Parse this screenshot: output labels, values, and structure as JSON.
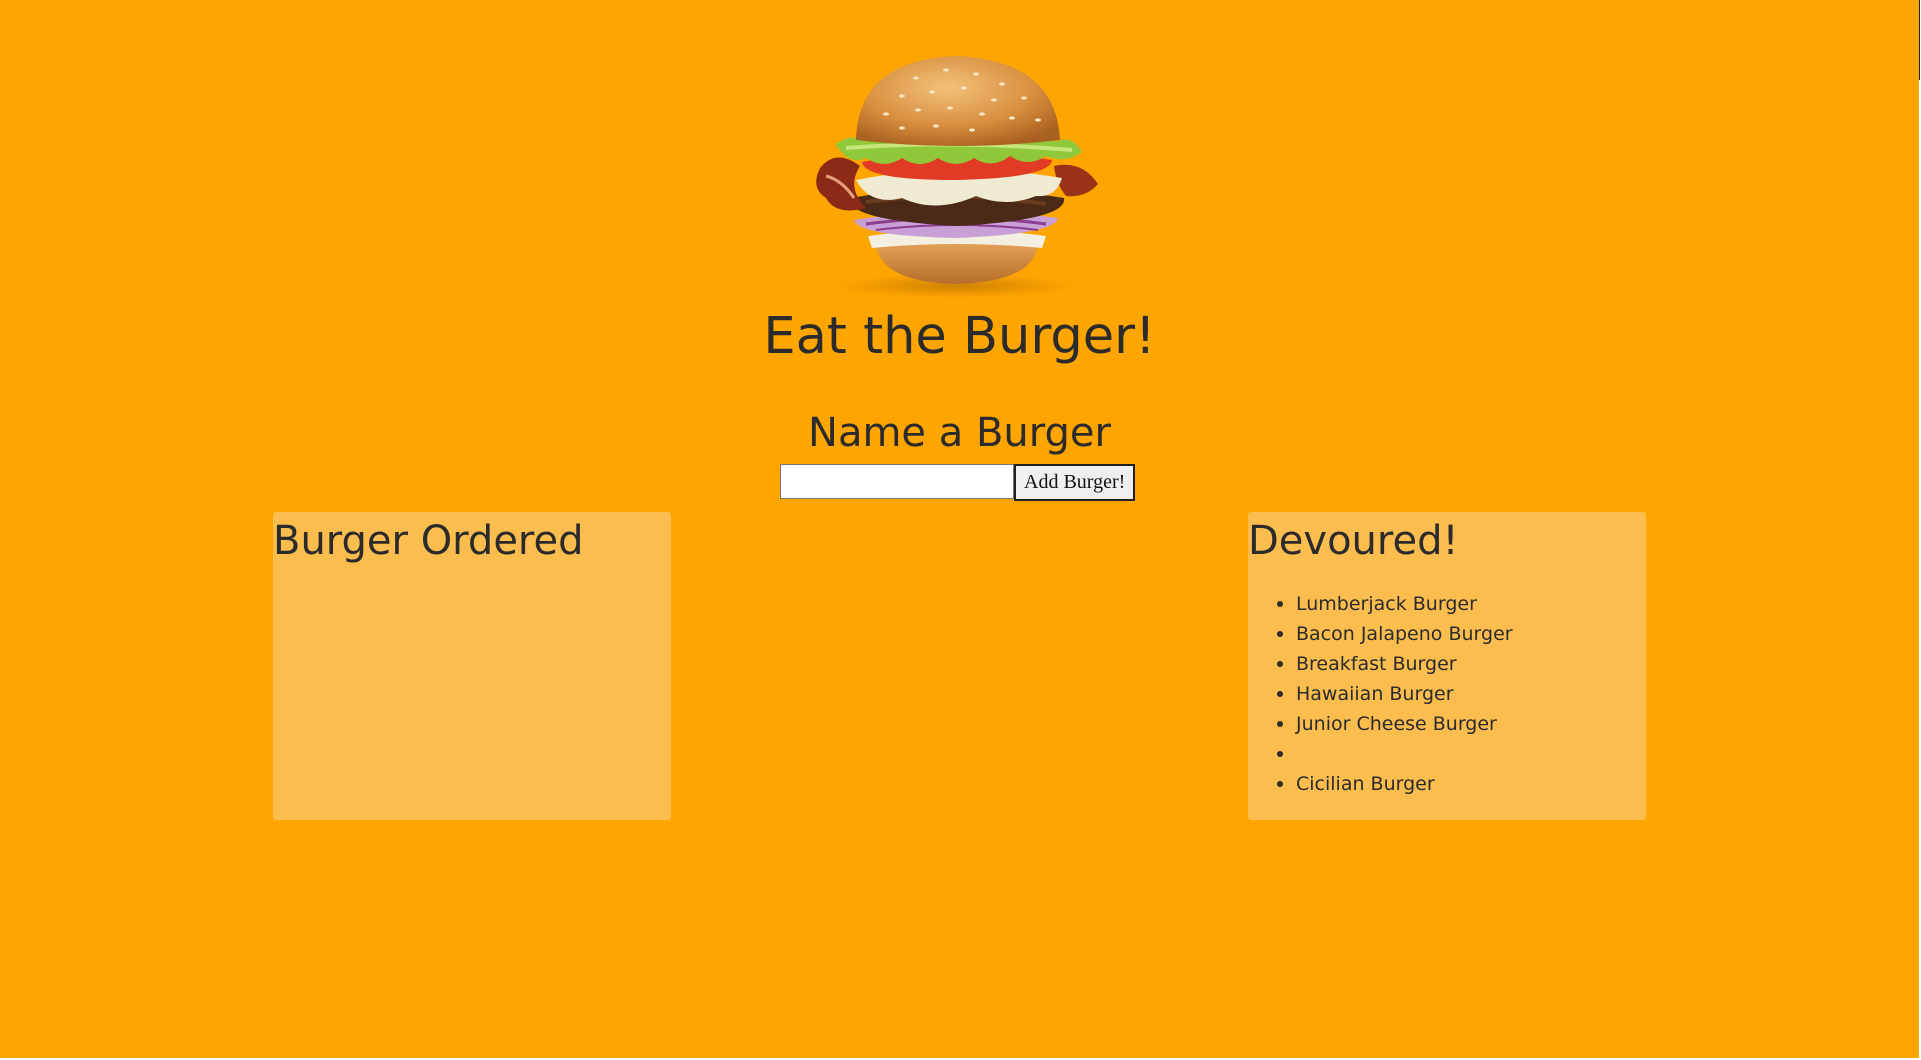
{
  "page": {
    "title": "Eat the Burger!",
    "background_color": "#ffa500",
    "hero_image": "burger-photo"
  },
  "form": {
    "heading": "Name a Burger",
    "input_value": "",
    "input_placeholder": "",
    "submit_label": "Add Burger!"
  },
  "ordered": {
    "heading": "Burger Ordered",
    "items": []
  },
  "devoured": {
    "heading": "Devoured!",
    "items": [
      "Lumberjack Burger",
      "Bacon Jalapeno Burger",
      "Breakfast Burger",
      "Hawaiian Burger",
      "Junior Cheese Burger",
      "",
      "Cicilian Burger"
    ]
  },
  "colors": {
    "panel": "#fcbd4f",
    "text": "#2b2b2b"
  }
}
